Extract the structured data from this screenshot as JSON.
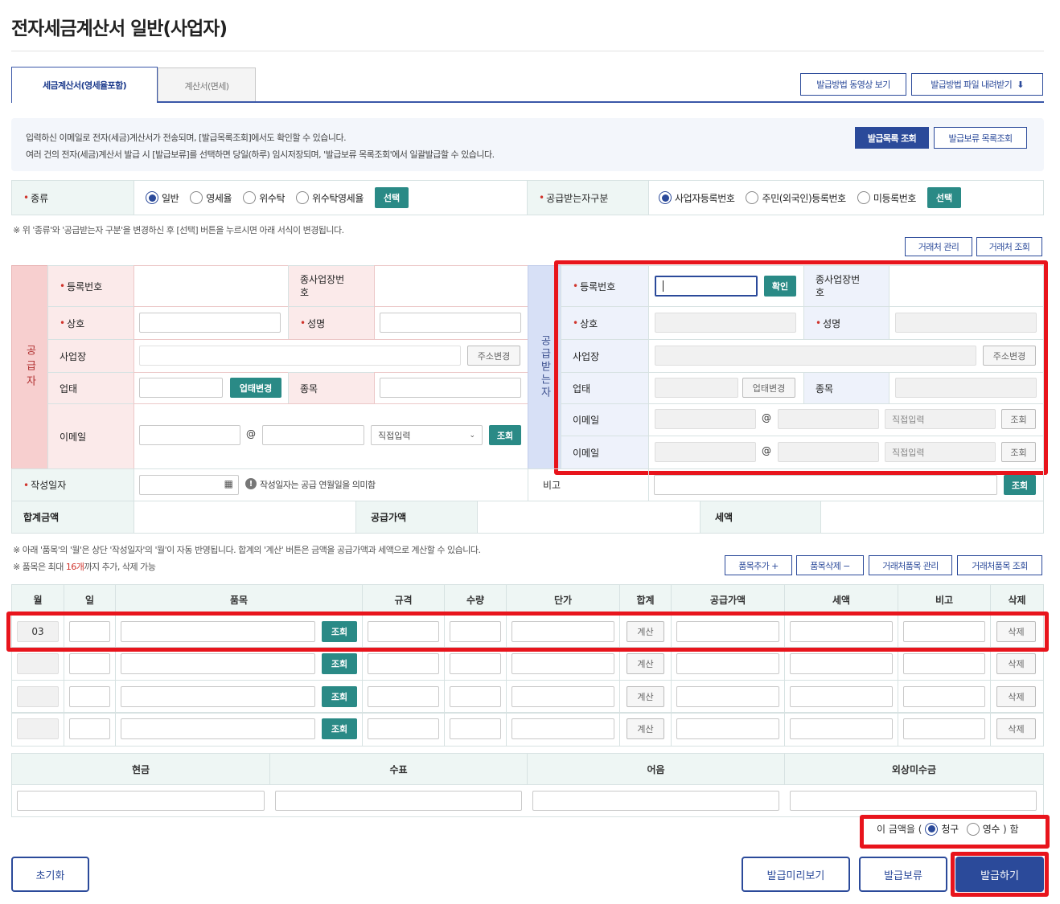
{
  "page": {
    "title": "전자세금계산서 일반(사업자)"
  },
  "tabs": [
    {
      "label": "세금계산서(영세율포함)",
      "active": true
    },
    {
      "label": "계산서(면세)",
      "active": false
    }
  ],
  "top_buttons": {
    "video": "발급방법 동영상 보기",
    "file": "발급방법 파일 내려받기",
    "download_icon": "⬇"
  },
  "notice": {
    "line1": "입력하신 이메일로 전자(세금)계산서가 전송되며, [발급목록조회]에서도 확인할 수 있습니다.",
    "line2": "여러 건의 전자(세금)계산서 발급 시 [발급보류]를 선택하면 당일(하루) 임시저장되며, '발급보류 목록조회'에서 일괄발급할 수 있습니다.",
    "btn_list": "발급목록 조회",
    "btn_hold_list": "발급보류 목록조회"
  },
  "type_row": {
    "label": "종류",
    "options": [
      "일반",
      "영세율",
      "위수탁",
      "위수탁영세율"
    ],
    "selected": "일반",
    "select_btn": "선택",
    "receiver_label": "공급받는자구분",
    "receiver_options": [
      "사업자등록번호",
      "주민(외국인)등록번호",
      "미등록번호"
    ],
    "receiver_selected": "사업자등록번호",
    "receiver_select_btn": "선택"
  },
  "type_note": "※ 위 '종류'와 '공급받는자 구분'을 변경하신 후 [선택] 버튼을 누르시면 아래 서식이 변경됩니다.",
  "partner_buttons": {
    "manage": "거래처 관리",
    "search": "거래처 조회"
  },
  "supplier": {
    "side_label": "공급자",
    "reg_no": "등록번호",
    "sub_biz": "종사업장번호",
    "company": "상호",
    "name": "성명",
    "address": "사업장",
    "addr_change": "주소변경",
    "biz_type": "업태",
    "biz_change": "업태변경",
    "item": "종목",
    "email": "이메일",
    "at": "@",
    "direct_input": "직접입력",
    "search": "조회"
  },
  "receiver": {
    "side_label": "공급받는자",
    "reg_no": "등록번호",
    "confirm": "확인",
    "sub_biz": "종사업장번호",
    "company": "상호",
    "name": "성명",
    "address": "사업장",
    "addr_change": "주소변경",
    "biz_type": "업태",
    "biz_change": "업태변경",
    "item": "종목",
    "email1": "이메일",
    "email2": "이메일",
    "at": "@",
    "direct_input": "직접입력",
    "search": "조회"
  },
  "date_row": {
    "label": "작성일자",
    "hint": "작성일자는 공급 연월일을 의미함",
    "remark": "비고",
    "remark_search": "조회",
    "calendar_icon": "▦",
    "info_icon": "!"
  },
  "sum_row": {
    "total": "합계금액",
    "supply": "공급가액",
    "tax": "세액"
  },
  "item_notes": {
    "line1": "※ 아래 '품목'의 '월'은 상단 '작성일자'의 '월'이 자동 반영됩니다. 합계의 '계산' 버튼은 금액을 공급가액과 세액으로 계산할 수 있습니다.",
    "line2_pre": "※ 품목은 최대 ",
    "line2_num": "16개",
    "line2_post": "까지 추가, 삭제 가능"
  },
  "item_buttons": {
    "add": "품목추가 +",
    "delete": "품목삭제 −",
    "manage": "거래처품목 관리",
    "search": "거래처품목 조회"
  },
  "items_table": {
    "headers": [
      "월",
      "일",
      "품목",
      "규격",
      "수량",
      "단가",
      "합계",
      "공급가액",
      "세액",
      "비고",
      "삭제"
    ],
    "search_btn": "조회",
    "calc_btn": "계산",
    "delete_btn": "삭제",
    "row1_month": "03"
  },
  "payment": {
    "headers": [
      "현금",
      "수표",
      "어음",
      "외상미수금"
    ]
  },
  "amount_type": {
    "prefix": "이 금액을 (",
    "claim": "청구",
    "receipt": "영수",
    "suffix": ") 함",
    "selected": "청구"
  },
  "bottom": {
    "reset": "초기화",
    "preview": "발급미리보기",
    "hold": "발급보류",
    "issue": "발급하기"
  }
}
